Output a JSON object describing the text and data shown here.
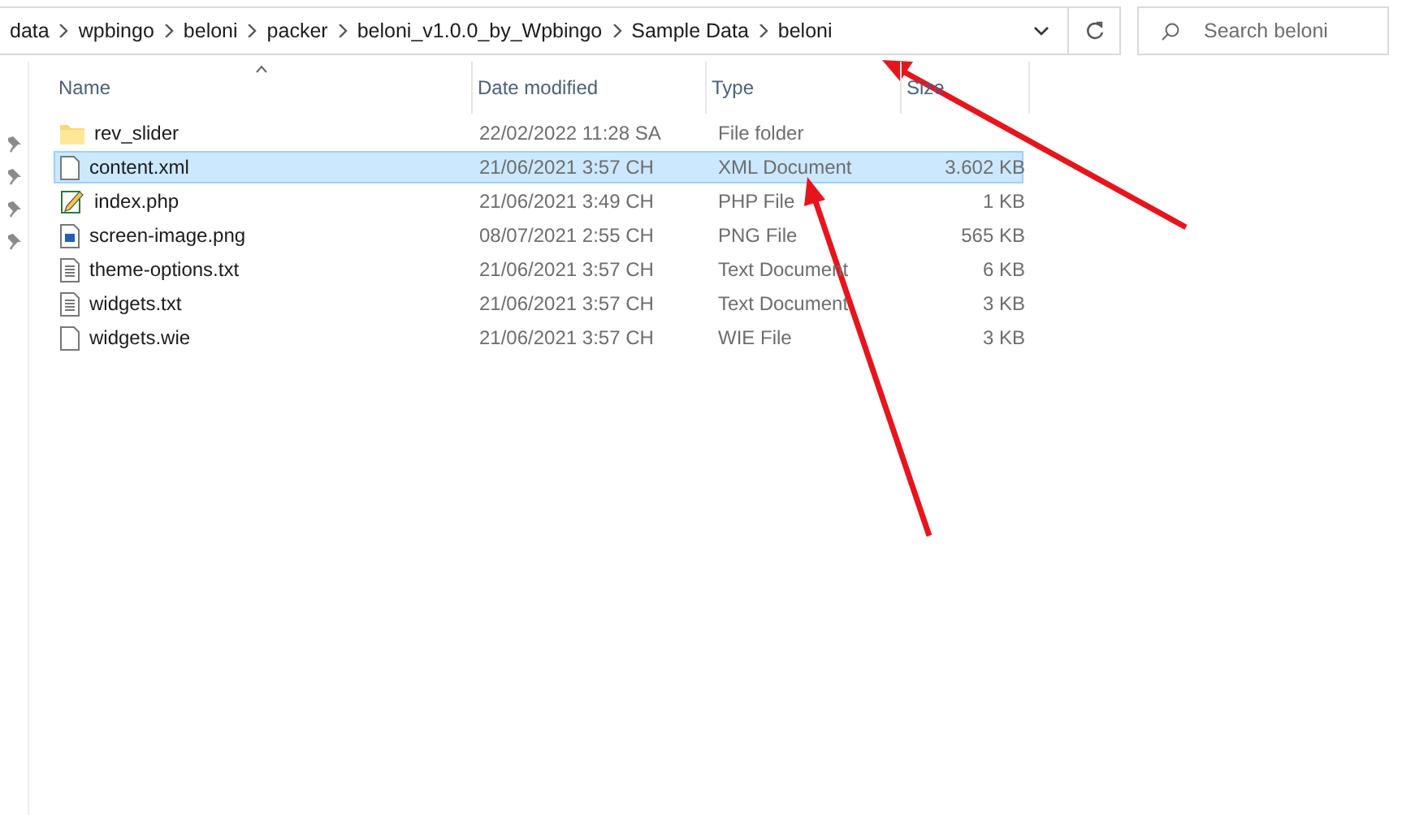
{
  "address_bar": {
    "path": [
      "data",
      "wpbingo",
      "beloni",
      "packer",
      "beloni_v1.0.0_by_Wpbingo",
      "Sample Data",
      "beloni"
    ]
  },
  "search": {
    "placeholder": "Search beloni"
  },
  "table": {
    "columns": [
      "Name",
      "Date modified",
      "Type",
      "Size"
    ],
    "rows": [
      {
        "kind": "folder",
        "name": "rev_slider",
        "date": "22/02/2022 11:28 SA",
        "type": "File folder",
        "size": "",
        "selected": false
      },
      {
        "kind": "file",
        "name": "content.xml",
        "date": "21/06/2021 3:57 CH",
        "type": "XML Document",
        "size": "3.602 KB",
        "selected": true
      },
      {
        "kind": "script",
        "name": "index.php",
        "date": "21/06/2021 3:49 CH",
        "type": "PHP File",
        "size": "1 KB",
        "selected": false
      },
      {
        "kind": "image",
        "name": "screen-image.png",
        "date": "08/07/2021 2:55 CH",
        "type": "PNG File",
        "size": "565 KB",
        "selected": false
      },
      {
        "kind": "text",
        "name": "theme-options.txt",
        "date": "21/06/2021 3:57 CH",
        "type": "Text Document",
        "size": "6 KB",
        "selected": false
      },
      {
        "kind": "text",
        "name": "widgets.txt",
        "date": "21/06/2021 3:57 CH",
        "type": "Text Document",
        "size": "3 KB",
        "selected": false
      },
      {
        "kind": "file",
        "name": "widgets.wie",
        "date": "21/06/2021 3:57 CH",
        "type": "WIE File",
        "size": "3 KB",
        "selected": false
      }
    ]
  }
}
